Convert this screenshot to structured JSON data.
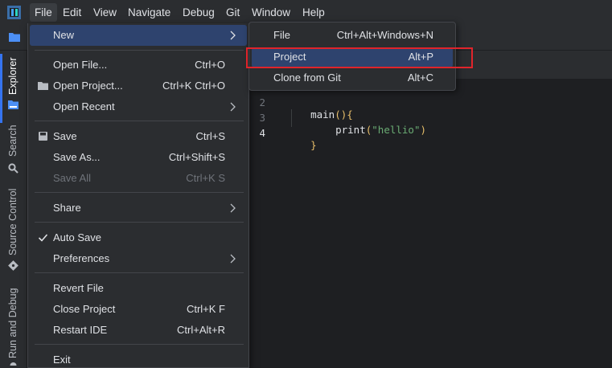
{
  "menubar": {
    "items": [
      "File",
      "Edit",
      "View",
      "Navigate",
      "Debug",
      "Git",
      "Window",
      "Help"
    ]
  },
  "activity": {
    "explorer": "Explorer",
    "search": "Search",
    "source_control": "Source Control",
    "run_debug": "Run and Debug"
  },
  "file_menu": {
    "new": "New",
    "open_file": "Open File...",
    "open_file_short": "Ctrl+O",
    "open_project": "Open Project...",
    "open_project_short": "Ctrl+K Ctrl+O",
    "open_recent": "Open Recent",
    "save": "Save",
    "save_short": "Ctrl+S",
    "save_as": "Save As...",
    "save_as_short": "Ctrl+Shift+S",
    "save_all": "Save All",
    "save_all_short": "Ctrl+K S",
    "share": "Share",
    "auto_save": "Auto Save",
    "preferences": "Preferences",
    "revert_file": "Revert File",
    "close_project": "Close Project",
    "close_project_short": "Ctrl+K F",
    "restart_ide": "Restart IDE",
    "restart_ide_short": "Ctrl+Alt+R",
    "exit": "Exit"
  },
  "new_submenu": {
    "file": "File",
    "file_short": "Ctrl+Alt+Windows+N",
    "project": "Project",
    "project_short": "Alt+P",
    "clone": "Clone from Git",
    "clone_short": "Alt+C"
  },
  "editor": {
    "line_numbers": [
      "2",
      "3",
      "4"
    ],
    "line2_fn": "main",
    "line2_rest": "(){",
    "line3_fn": "print",
    "line3_open": "(",
    "line3_str": "\"hellio\"",
    "line3_close": ")",
    "line4": "}"
  },
  "colors": {
    "accent": "#3574f0",
    "menu_hover": "#2e436e",
    "highlight_outline": "#e0242b",
    "string": "#6aab73",
    "function": "#e8bf6a"
  }
}
